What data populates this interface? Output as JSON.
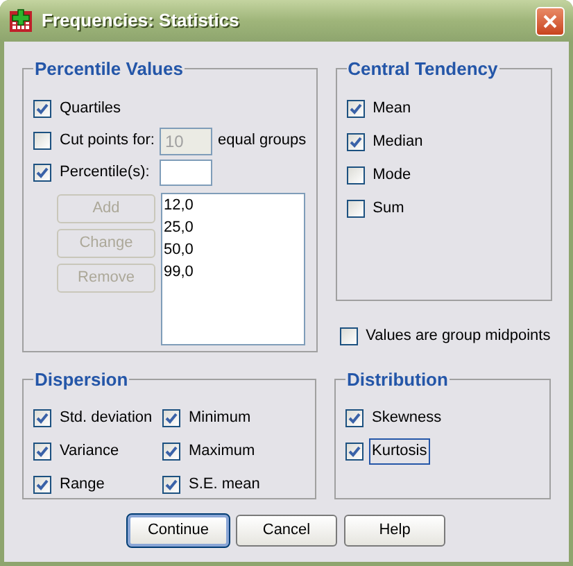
{
  "window": {
    "title": "Frequencies: Statistics"
  },
  "percentile_values": {
    "title": "Percentile Values",
    "quartiles": {
      "label": "Quartiles",
      "checked": true
    },
    "cut_points": {
      "label": "Cut points for:",
      "checked": false,
      "value": "10",
      "disabled": true,
      "suffix": "equal groups"
    },
    "percentiles": {
      "label": "Percentile(s):",
      "checked": true
    },
    "buttons": [
      {
        "label": "Add",
        "disabled": true
      },
      {
        "label": "Change",
        "disabled": true
      },
      {
        "label": "Remove",
        "disabled": true
      }
    ],
    "list": [
      "12,0",
      "25,0",
      "50,0",
      "99,0"
    ]
  },
  "central_tendency": {
    "title": "Central Tendency",
    "items": [
      {
        "label": "Mean",
        "checked": true
      },
      {
        "label": "Median",
        "checked": true
      },
      {
        "label": "Mode",
        "checked": false
      },
      {
        "label": "Sum",
        "checked": false
      }
    ]
  },
  "group_midpoints": {
    "label": "Values are group midpoints",
    "checked": false
  },
  "dispersion": {
    "title": "Dispersion",
    "items": [
      {
        "label": "Std. deviation",
        "checked": true
      },
      {
        "label": "Minimum",
        "checked": true
      },
      {
        "label": "Variance",
        "checked": true
      },
      {
        "label": "Maximum",
        "checked": true
      },
      {
        "label": "Range",
        "checked": true
      },
      {
        "label": "S.E. mean",
        "checked": true
      }
    ]
  },
  "distribution": {
    "title": "Distribution",
    "items": [
      {
        "label": "Skewness",
        "checked": true,
        "focused": false
      },
      {
        "label": "Kurtosis",
        "checked": true,
        "focused": true
      }
    ]
  },
  "buttons": [
    {
      "label": "Continue",
      "default": true
    },
    {
      "label": "Cancel",
      "default": false
    },
    {
      "label": "Help",
      "default": false
    }
  ]
}
